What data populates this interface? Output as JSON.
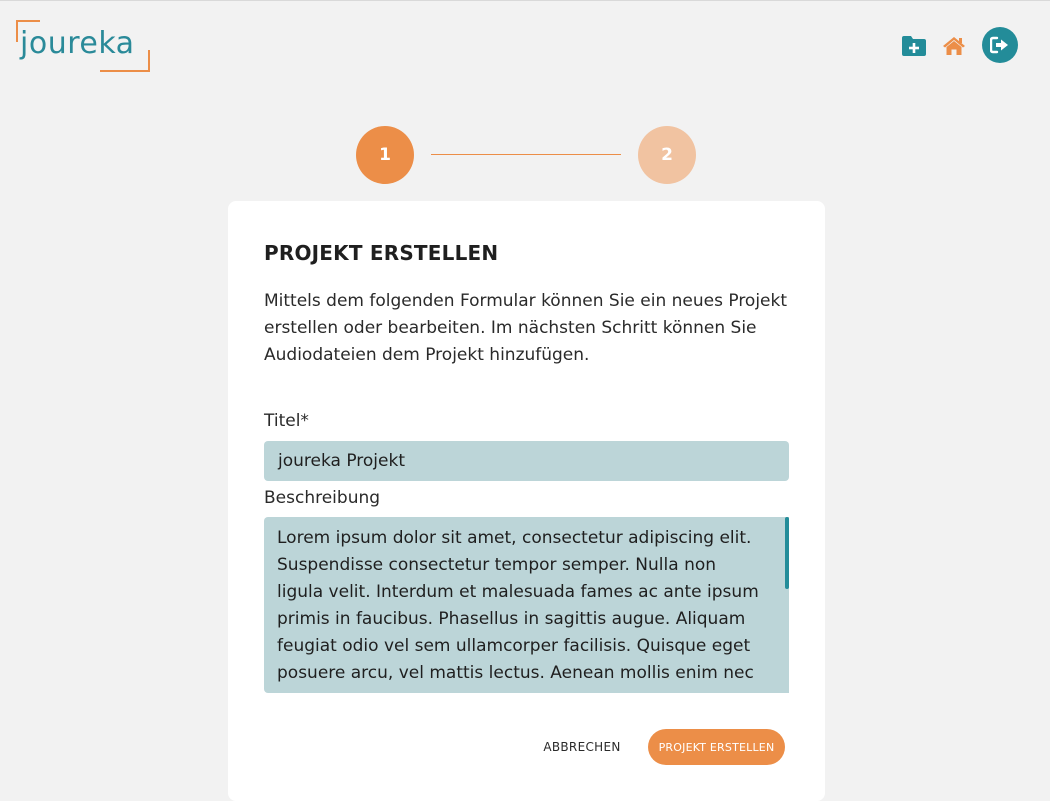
{
  "header": {
    "logo_text": "joureka",
    "icons": [
      "folder-plus-icon",
      "home-icon",
      "logout-icon"
    ]
  },
  "stepper": {
    "steps": [
      {
        "number": "1",
        "state": "active"
      },
      {
        "number": "2",
        "state": "inactive"
      }
    ]
  },
  "card": {
    "title": "PROJEKT ERSTELLEN",
    "description": "Mittels dem folgenden Formular können Sie ein neues Projekt erstellen oder bearbeiten. Im nächsten Schritt können Sie Audiodateien dem Projekt hinzufügen.",
    "fields": {
      "title_label": "Titel*",
      "title_value": "joureka Projekt",
      "description_label": "Beschreibung",
      "description_value": "Lorem ipsum dolor sit amet, consectetur adipiscing elit. Suspendisse consectetur tempor semper. Nulla non ligula velit. Interdum et malesuada fames ac ante ipsum primis in faucibus. Phasellus in sagittis augue. Aliquam feugiat odio vel sem ullamcorper facilisis. Quisque eget posuere arcu, vel mattis lectus. Aenean mollis enim nec neque"
    },
    "buttons": {
      "cancel_label": "ABBRECHEN",
      "create_label": "PROJEKT ERSTELLEN"
    }
  },
  "colors": {
    "accent_orange": "#ec8e48",
    "accent_orange_light": "#f1c3a1",
    "teal": "#238c99",
    "field_bg": "#bcd5d8",
    "page_bg": "#f2f2f2"
  }
}
